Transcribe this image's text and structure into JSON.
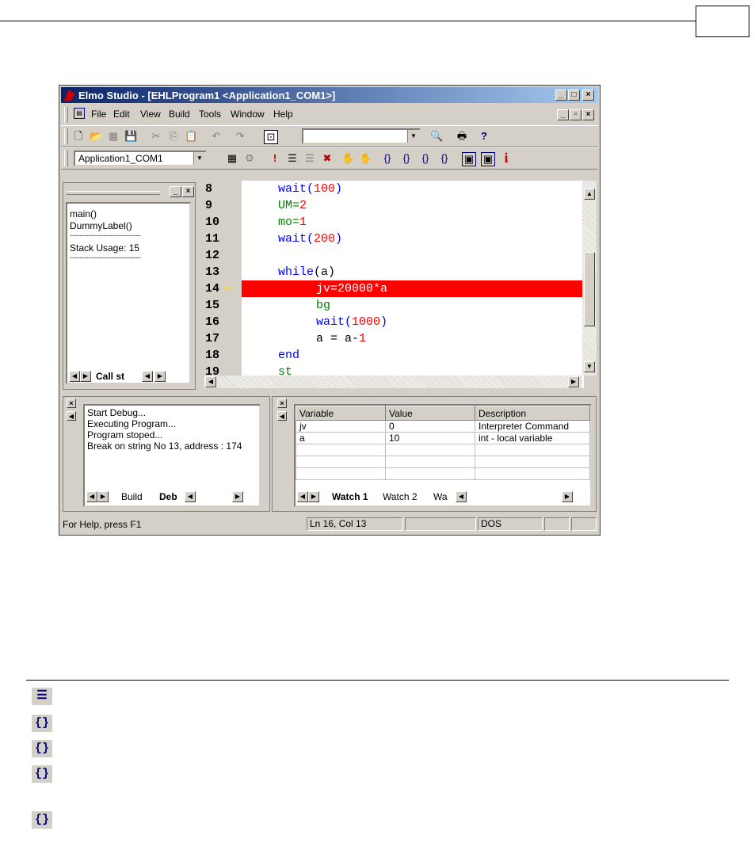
{
  "window": {
    "title": "Elmo Studio - [EHLProgram1 <Application1_COM1>]",
    "caption_buttons": [
      "minimize-icon",
      "maximize-icon",
      "close-icon"
    ]
  },
  "menu": {
    "items": [
      "File",
      "Edit",
      "View",
      "Build",
      "Tools",
      "Window",
      "Help"
    ]
  },
  "toolbar": {
    "find_combo_value": "",
    "target_combo_value": "Application1_COM1",
    "info_icon_label": "i"
  },
  "callstack": {
    "lines": [
      "main()",
      "DummyLabel()",
      "------------------------------",
      "Stack Usage: 15",
      "------------------------------"
    ],
    "tab_label": "Call st"
  },
  "editor": {
    "lines": [
      {
        "n": "8",
        "code": "wait(100)"
      },
      {
        "n": "9",
        "code": "UM=2"
      },
      {
        "n": "10",
        "code": "mo=1"
      },
      {
        "n": "11",
        "code": "wait(200)"
      },
      {
        "n": "12",
        "code": ""
      },
      {
        "n": "13",
        "code": "while(a)"
      },
      {
        "n": "14",
        "code": "jv=20000*a"
      },
      {
        "n": "15",
        "code": "bg"
      },
      {
        "n": "16",
        "code": "wait(1000)"
      },
      {
        "n": "17",
        "code": "a = a-1"
      },
      {
        "n": "18",
        "code": "end"
      },
      {
        "n": "19",
        "code": "st"
      }
    ],
    "current_line": "14",
    "current_line_color": "#ff0000"
  },
  "output": {
    "lines": [
      "Start Debug...",
      "Executing Program...",
      "Program stoped...",
      "Break on string No 13, address : 174"
    ],
    "tabs": [
      "Build",
      "Deb"
    ]
  },
  "watch": {
    "columns": [
      "Variable",
      "Value",
      "Description"
    ],
    "rows": [
      [
        "jv",
        "0",
        "Interpreter Command"
      ],
      [
        "a",
        "10",
        "int - local variable"
      ]
    ],
    "tabs": [
      "Watch 1",
      "Watch 2",
      "Wa"
    ]
  },
  "statusbar": {
    "help": "For Help, press F1",
    "position": "Ln 16, Col 13",
    "mode": "DOS"
  },
  "legend_icons": [
    "step-line-icon",
    "step-into-icon",
    "step-over-icon",
    "step-out-icon",
    "run-to-cursor-icon"
  ]
}
